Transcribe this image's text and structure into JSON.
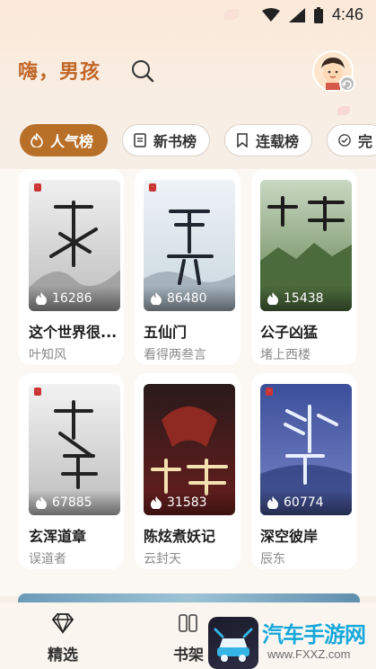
{
  "status_bar": {
    "time": "4:46"
  },
  "header": {
    "greeting": "嗨，男孩"
  },
  "tabs": [
    {
      "label": "人气榜",
      "icon": "flame-icon",
      "active": true
    },
    {
      "label": "新书榜",
      "icon": "book-icon",
      "active": false
    },
    {
      "label": "连载榜",
      "icon": "bookmark-icon",
      "active": false
    },
    {
      "label": "完",
      "icon": "check-circle-icon",
      "active": false
    }
  ],
  "books": [
    {
      "title": "这个世界很...",
      "author": "叶知风",
      "heat": "16286",
      "cover_title": "这个世界很危险",
      "cover_color": "#d9d9d9"
    },
    {
      "title": "五仙门",
      "author": "看得两叁言",
      "heat": "86480",
      "cover_title": "五仙门",
      "cover_color": "#e6eef4"
    },
    {
      "title": "公子凶猛",
      "author": "堵上西楼",
      "heat": "15438",
      "cover_title": "公子凶猛",
      "cover_color": "#6e8f5a"
    },
    {
      "title": "玄浑道章",
      "author": "误道者",
      "heat": "67885",
      "cover_title": "玄浑道章",
      "cover_color": "#d3d3d3"
    },
    {
      "title": "陈炫煮妖记",
      "author": "云封天",
      "heat": "31583",
      "cover_title": "煮妖记",
      "cover_color": "#3a1a1a"
    },
    {
      "title": "深空彼岸",
      "author": "辰东",
      "heat": "60774",
      "cover_title": "深空彼岸",
      "cover_color": "#4a5fa6"
    }
  ],
  "bottom_nav": [
    {
      "label": "精选",
      "icon": "diamond-icon"
    },
    {
      "label": "书架",
      "icon": "bookshelf-icon"
    }
  ],
  "watermark": {
    "text": "汽车手游网",
    "sub": "www.FXXZ.com"
  },
  "colors": {
    "accent": "#b86f28",
    "greeting": "#c16728",
    "background": "#f6efe7"
  }
}
